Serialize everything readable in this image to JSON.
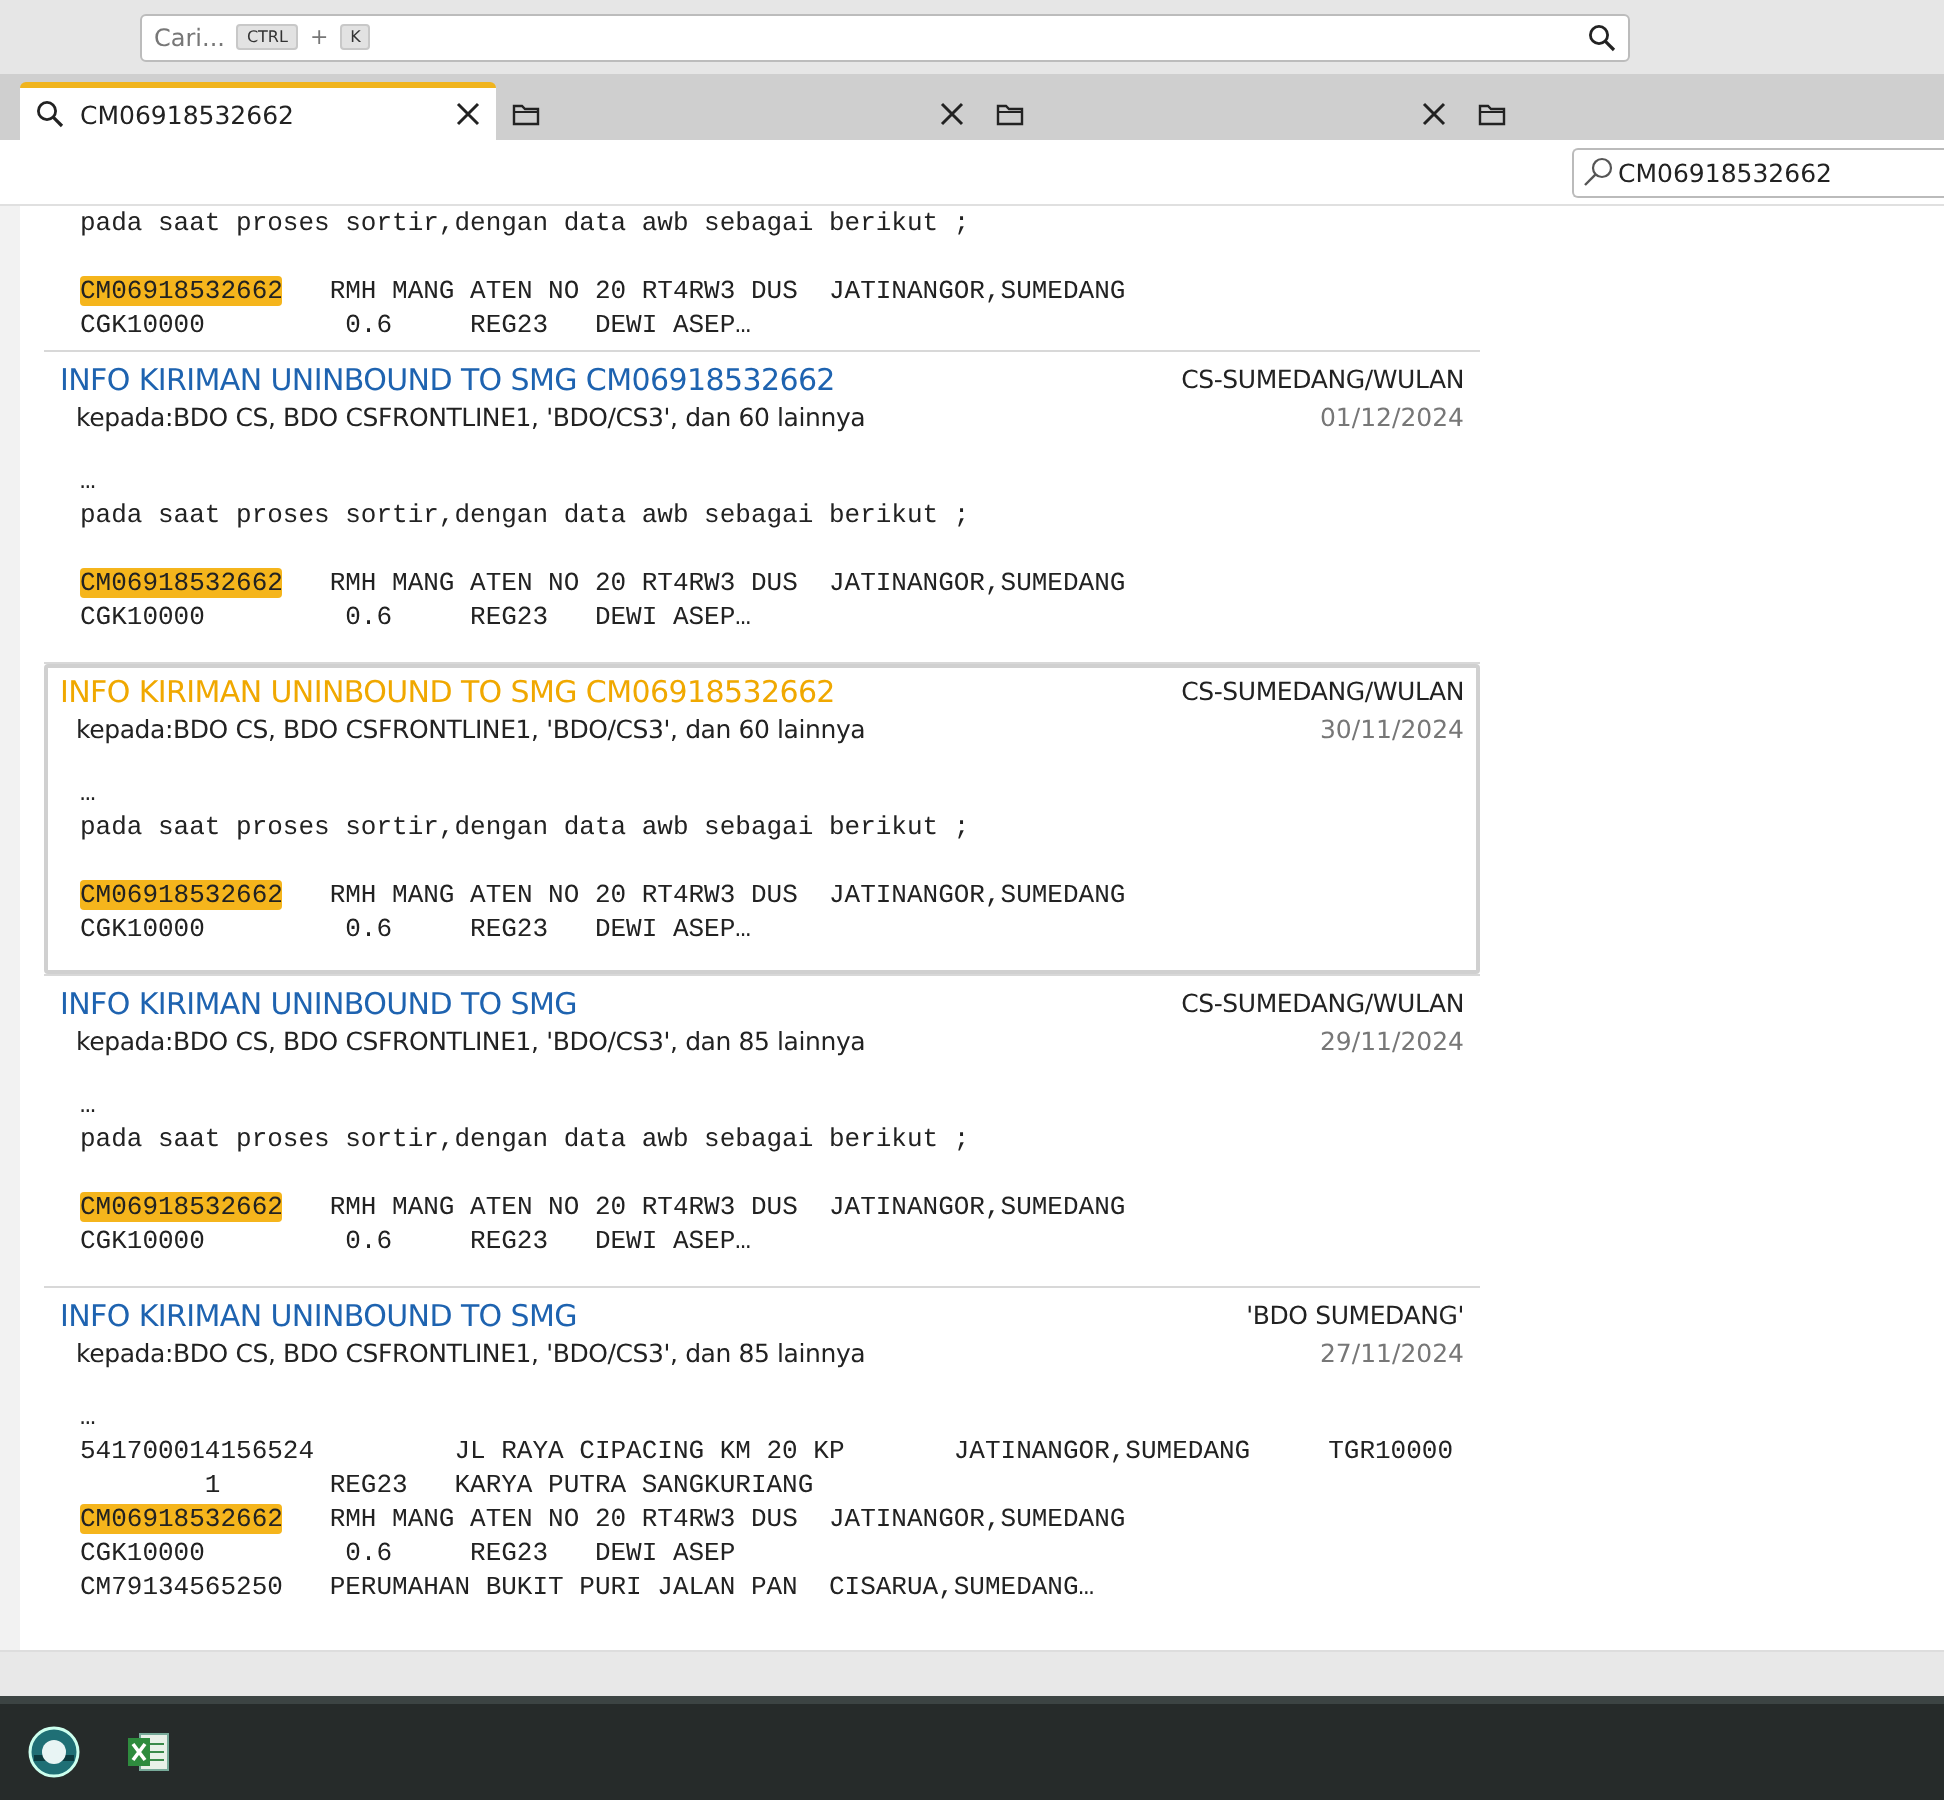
{
  "command_bar": {
    "placeholder": "Cari...",
    "keys": [
      "CTRL",
      "+",
      "K"
    ]
  },
  "tabs": [
    {
      "label": "CM06918532662",
      "kind": "search",
      "selected": true,
      "closable": true
    },
    {
      "kind": "folder",
      "selected": false,
      "closable": true
    },
    {
      "kind": "folder",
      "selected": false,
      "closable": true
    },
    {
      "kind": "folder",
      "selected": false,
      "closable": false
    }
  ],
  "filter": {
    "value": "CM06918532662"
  },
  "partial_message": {
    "paragraphs": [
      [
        {
          "text": "pada saat proses sortir,dengan data awb sebagai berikut ;"
        }
      ],
      [
        {
          "highlight": "CM06918532662",
          "text": "   RMH MANG ATEN NO 20 RT4RW3 DUS  JATINANGOR,SUMEDANG"
        },
        {
          "text": "CGK10000         0.6     REG23   DEWI ASEP…"
        }
      ]
    ]
  },
  "messages": [
    {
      "title": "INFO KIRIMAN UNINBOUND TO SMG CM06918532662",
      "sender": "CS-SUMEDANG/WULAN",
      "date": "01/12/2024",
      "recipients": "kepada:BDO CS, BDO CSFRONTLINE1, 'BDO/CS3', dan 60 lainnya",
      "selected": false,
      "paragraphs": [
        [
          {
            "text": "…"
          },
          {
            "text": "pada saat proses sortir,dengan data awb sebagai berikut ;"
          }
        ],
        [
          {
            "highlight": "CM06918532662",
            "text": "   RMH MANG ATEN NO 20 RT4RW3 DUS  JATINANGOR,SUMEDANG"
          },
          {
            "text": "CGK10000         0.6     REG23   DEWI ASEP…"
          }
        ]
      ]
    },
    {
      "title": "INFO KIRIMAN UNINBOUND TO SMG CM06918532662",
      "sender": "CS-SUMEDANG/WULAN",
      "date": "30/11/2024",
      "recipients": "kepada:BDO CS, BDO CSFRONTLINE1, 'BDO/CS3', dan 60 lainnya",
      "selected": true,
      "paragraphs": [
        [
          {
            "text": "…"
          },
          {
            "text": "pada saat proses sortir,dengan data awb sebagai berikut ;"
          }
        ],
        [
          {
            "highlight": "CM06918532662",
            "text": "   RMH MANG ATEN NO 20 RT4RW3 DUS  JATINANGOR,SUMEDANG"
          },
          {
            "text": "CGK10000         0.6     REG23   DEWI ASEP…"
          }
        ]
      ]
    },
    {
      "title": "INFO KIRIMAN UNINBOUND TO SMG",
      "sender": "CS-SUMEDANG/WULAN",
      "date": "29/11/2024",
      "recipients": "kepada:BDO CS, BDO CSFRONTLINE1, 'BDO/CS3', dan 85 lainnya",
      "selected": false,
      "paragraphs": [
        [
          {
            "text": "…"
          },
          {
            "text": "pada saat proses sortir,dengan data awb sebagai berikut ;"
          }
        ],
        [
          {
            "highlight": "CM06918532662",
            "text": "   RMH MANG ATEN NO 20 RT4RW3 DUS  JATINANGOR,SUMEDANG"
          },
          {
            "text": "CGK10000         0.6     REG23   DEWI ASEP…"
          }
        ]
      ]
    },
    {
      "title": "INFO KIRIMAN UNINBOUND TO SMG",
      "sender": "'BDO SUMEDANG'",
      "date": "27/11/2024",
      "recipients": "kepada:BDO CS, BDO CSFRONTLINE1, 'BDO/CS3', dan 85 lainnya",
      "selected": false,
      "paragraphs": [
        [
          {
            "text": "…"
          },
          {
            "text": "541700014156524         JL RAYA CIPACING KM 20 KP       JATINANGOR,SUMEDANG     TGR10000"
          },
          {
            "text": "        1       REG23   KARYA PUTRA SANGKURIANG"
          },
          {
            "highlight": "CM06918532662",
            "text": "   RMH MANG ATEN NO 20 RT4RW3 DUS  JATINANGOR,SUMEDANG"
          },
          {
            "text": "CGK10000         0.6     REG23   DEWI ASEP"
          },
          {
            "text": "CM79134565250   PERUMAHAN BUKIT PURI JALAN PAN  CISARUA,SUMEDANG…"
          }
        ]
      ]
    }
  ]
}
